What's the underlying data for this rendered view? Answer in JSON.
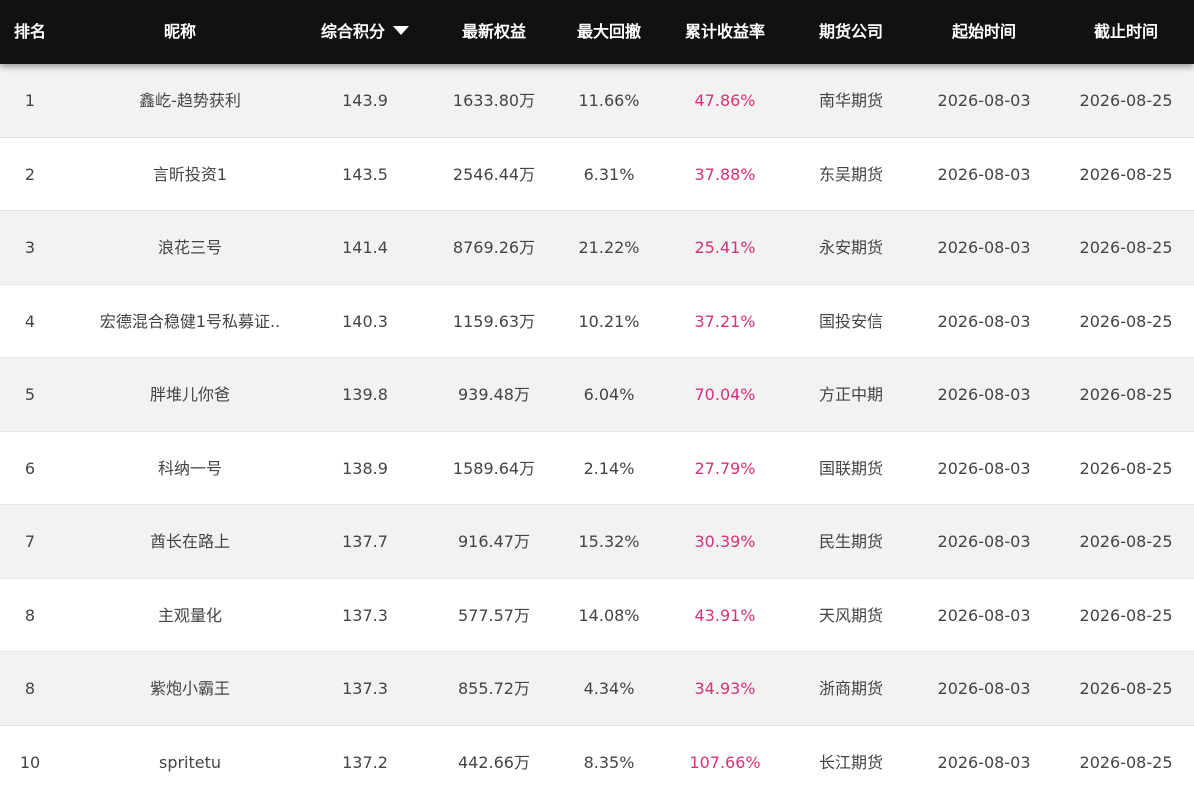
{
  "table": {
    "headers": {
      "rank": "排名",
      "nickname": "昵称",
      "score": "综合积分",
      "equity": "最新权益",
      "drawdown": "最大回撤",
      "return": "累计收益率",
      "company": "期货公司",
      "start": "起始时间",
      "end": "截止时间"
    },
    "sort": {
      "column": "综合积分",
      "direction": "desc",
      "icon": "caret-down-icon"
    },
    "colors": {
      "header_bg": "#111111",
      "return_color": "#d6317a",
      "odd_row": "#f2f2f2",
      "even_row": "#ffffff"
    },
    "rows": [
      {
        "rank": "1",
        "nickname": "鑫屹-趋势获利",
        "score": "143.9",
        "equity": "1633.80万",
        "drawdown": "11.66%",
        "return": "47.86%",
        "company": "南华期货",
        "start": "2026-08-03",
        "end": "2026-08-25"
      },
      {
        "rank": "2",
        "nickname": "言昕投资1",
        "score": "143.5",
        "equity": "2546.44万",
        "drawdown": "6.31%",
        "return": "37.88%",
        "company": "东吴期货",
        "start": "2026-08-03",
        "end": "2026-08-25"
      },
      {
        "rank": "3",
        "nickname": "浪花三号",
        "score": "141.4",
        "equity": "8769.26万",
        "drawdown": "21.22%",
        "return": "25.41%",
        "company": "永安期货",
        "start": "2026-08-03",
        "end": "2026-08-25"
      },
      {
        "rank": "4",
        "nickname": "宏德混合稳健1号私募证..",
        "score": "140.3",
        "equity": "1159.63万",
        "drawdown": "10.21%",
        "return": "37.21%",
        "company": "国投安信",
        "start": "2026-08-03",
        "end": "2026-08-25"
      },
      {
        "rank": "5",
        "nickname": "胖堆儿你爸",
        "score": "139.8",
        "equity": "939.48万",
        "drawdown": "6.04%",
        "return": "70.04%",
        "company": "方正中期",
        "start": "2026-08-03",
        "end": "2026-08-25"
      },
      {
        "rank": "6",
        "nickname": "科纳一号",
        "score": "138.9",
        "equity": "1589.64万",
        "drawdown": "2.14%",
        "return": "27.79%",
        "company": "国联期货",
        "start": "2026-08-03",
        "end": "2026-08-25"
      },
      {
        "rank": "7",
        "nickname": "酋长在路上",
        "score": "137.7",
        "equity": "916.47万",
        "drawdown": "15.32%",
        "return": "30.39%",
        "company": "民生期货",
        "start": "2026-08-03",
        "end": "2026-08-25"
      },
      {
        "rank": "8",
        "nickname": "主观量化",
        "score": "137.3",
        "equity": "577.57万",
        "drawdown": "14.08%",
        "return": "43.91%",
        "company": "天风期货",
        "start": "2026-08-03",
        "end": "2026-08-25"
      },
      {
        "rank": "8",
        "nickname": "紫炮小霸王",
        "score": "137.3",
        "equity": "855.72万",
        "drawdown": "4.34%",
        "return": "34.93%",
        "company": "浙商期货",
        "start": "2026-08-03",
        "end": "2026-08-25"
      },
      {
        "rank": "10",
        "nickname": "spritetu",
        "score": "137.2",
        "equity": "442.66万",
        "drawdown": "8.35%",
        "return": "107.66%",
        "company": "长江期货",
        "start": "2026-08-03",
        "end": "2026-08-25"
      }
    ]
  }
}
